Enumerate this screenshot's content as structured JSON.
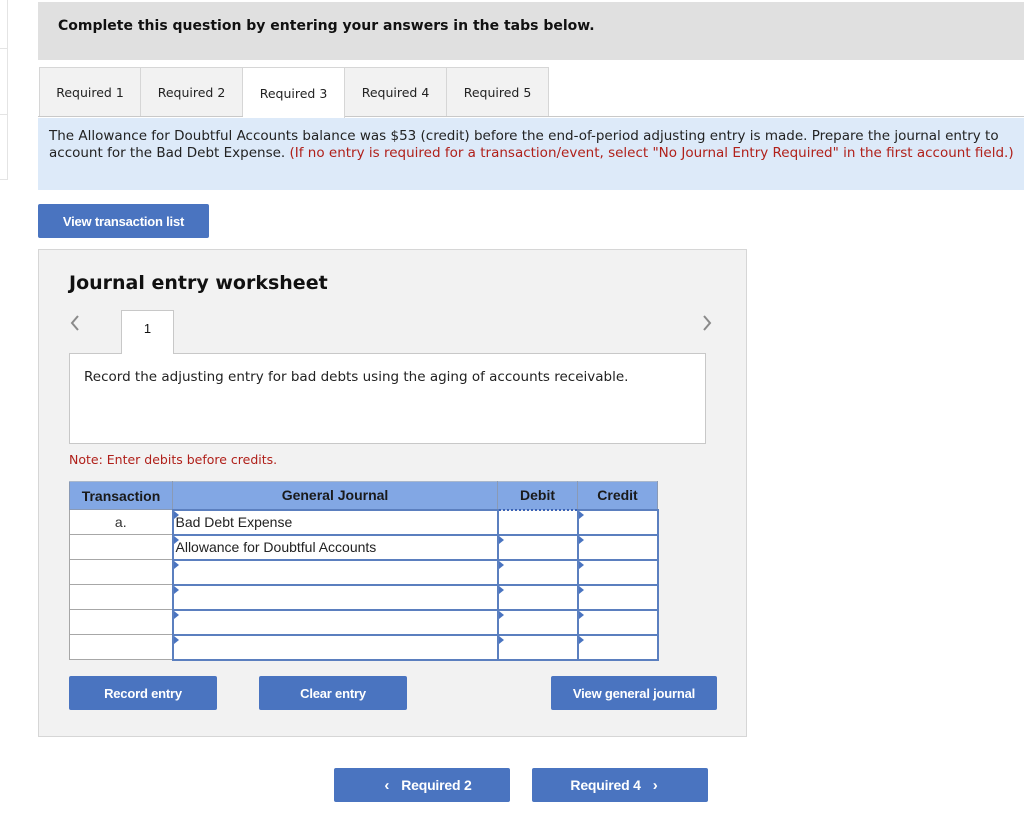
{
  "banner": {
    "text": "Complete this question by entering your answers in the tabs below."
  },
  "tabs": [
    {
      "label": "Required 1",
      "active": false
    },
    {
      "label": "Required 2",
      "active": false
    },
    {
      "label": "Required 3",
      "active": true
    },
    {
      "label": "Required 4",
      "active": false
    },
    {
      "label": "Required 5",
      "active": false
    }
  ],
  "instructions": {
    "text": "The Allowance for Doubtful Accounts balance was $53 (credit) before the end-of-period adjusting entry is made. Prepare the journal entry to account for the Bad Debt Expense. ",
    "note": "(If no entry is required for a transaction/event, select \"No Journal Entry Required\" in the first account field.)"
  },
  "buttons": {
    "view_transaction_list": "View transaction list",
    "record_entry": "Record entry",
    "clear_entry": "Clear entry",
    "view_general_journal": "View general journal",
    "prev_required": "Required 2",
    "next_required": "Required 4"
  },
  "worksheet": {
    "title": "Journal entry worksheet",
    "current_page": "1",
    "description": "Record the adjusting entry for bad debts using the aging of accounts receivable.",
    "note": "Note: Enter debits before credits.",
    "columns": [
      "Transaction",
      "General Journal",
      "Debit",
      "Credit"
    ],
    "rows": [
      {
        "transaction": "a.",
        "account": "Bad Debt Expense",
        "debit": "",
        "credit": ""
      },
      {
        "transaction": "",
        "account": "Allowance for Doubtful Accounts",
        "debit": "",
        "credit": ""
      },
      {
        "transaction": "",
        "account": "",
        "debit": "",
        "credit": ""
      },
      {
        "transaction": "",
        "account": "",
        "debit": "",
        "credit": ""
      },
      {
        "transaction": "",
        "account": "",
        "debit": "",
        "credit": ""
      },
      {
        "transaction": "",
        "account": "",
        "debit": "",
        "credit": ""
      }
    ]
  },
  "icons": {
    "prev_page": "chevron-left-icon",
    "next_page": "chevron-right-icon",
    "prev_required_chevron": "‹",
    "next_required_chevron": "›"
  },
  "colors": {
    "accent": "#4a74c0",
    "header_blue": "#82a7e4",
    "info_bg": "#ddeaf9",
    "warning_red": "#b0201a"
  }
}
